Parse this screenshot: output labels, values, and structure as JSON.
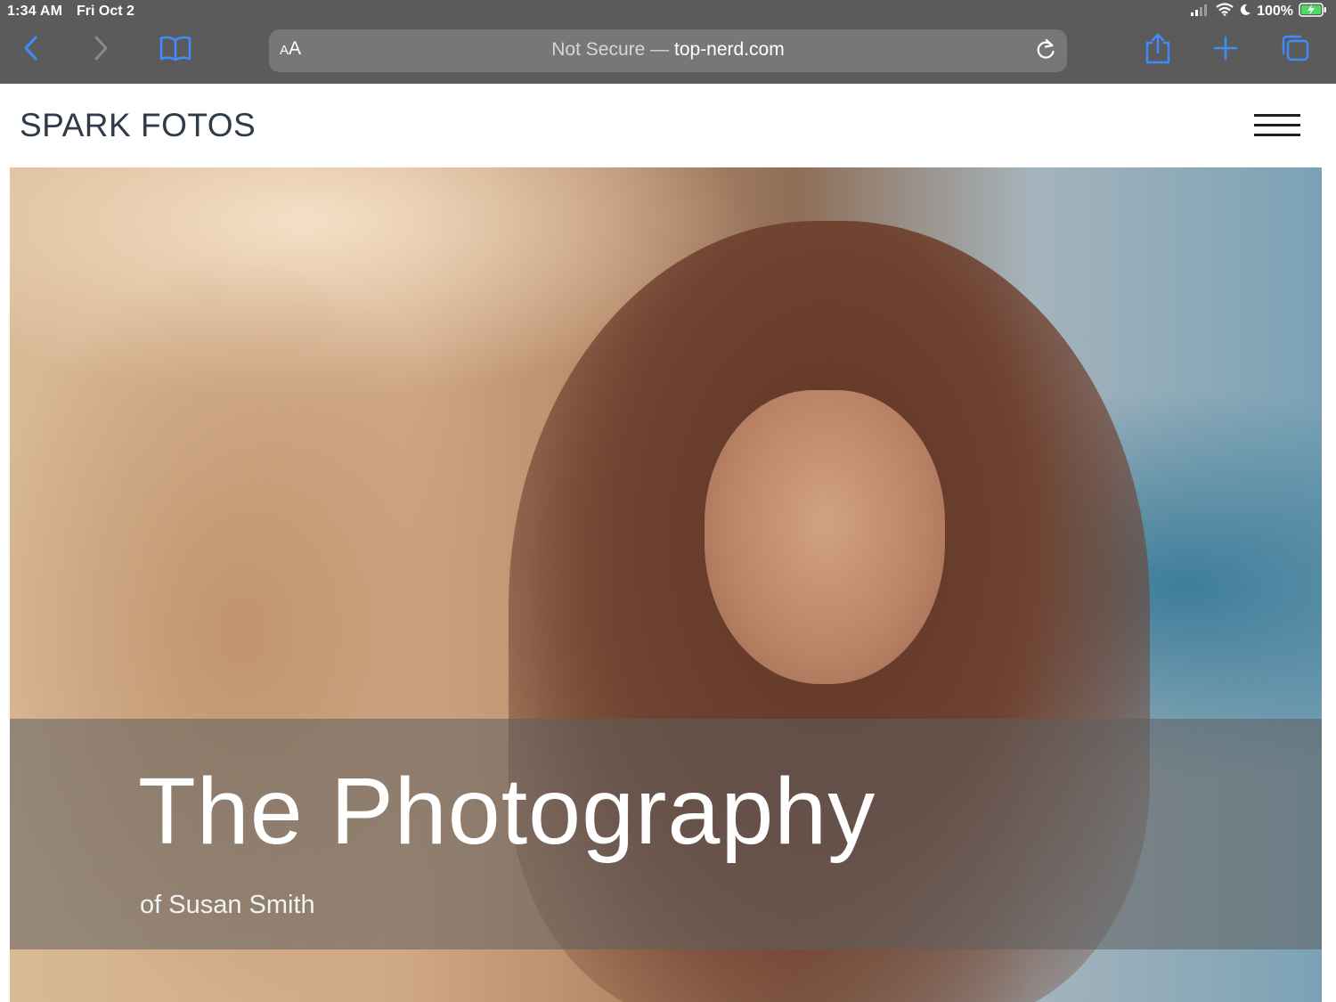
{
  "status_bar": {
    "time": "1:34 AM",
    "date": "Fri Oct 2",
    "battery": "100%"
  },
  "browser": {
    "text_size_small": "A",
    "text_size_large": "A",
    "security_label": "Not Secure —",
    "domain": "top-nerd.com",
    "accent_color": "#3f8cff",
    "icons": [
      "back-icon",
      "forward-icon",
      "bookmarks-icon",
      "reload-icon",
      "share-icon",
      "new-tab-icon",
      "tabs-icon"
    ]
  },
  "site": {
    "logo": "SPARK FOTOS",
    "hero": {
      "title": "The Photography",
      "subtitle": "of Susan Smith"
    }
  }
}
